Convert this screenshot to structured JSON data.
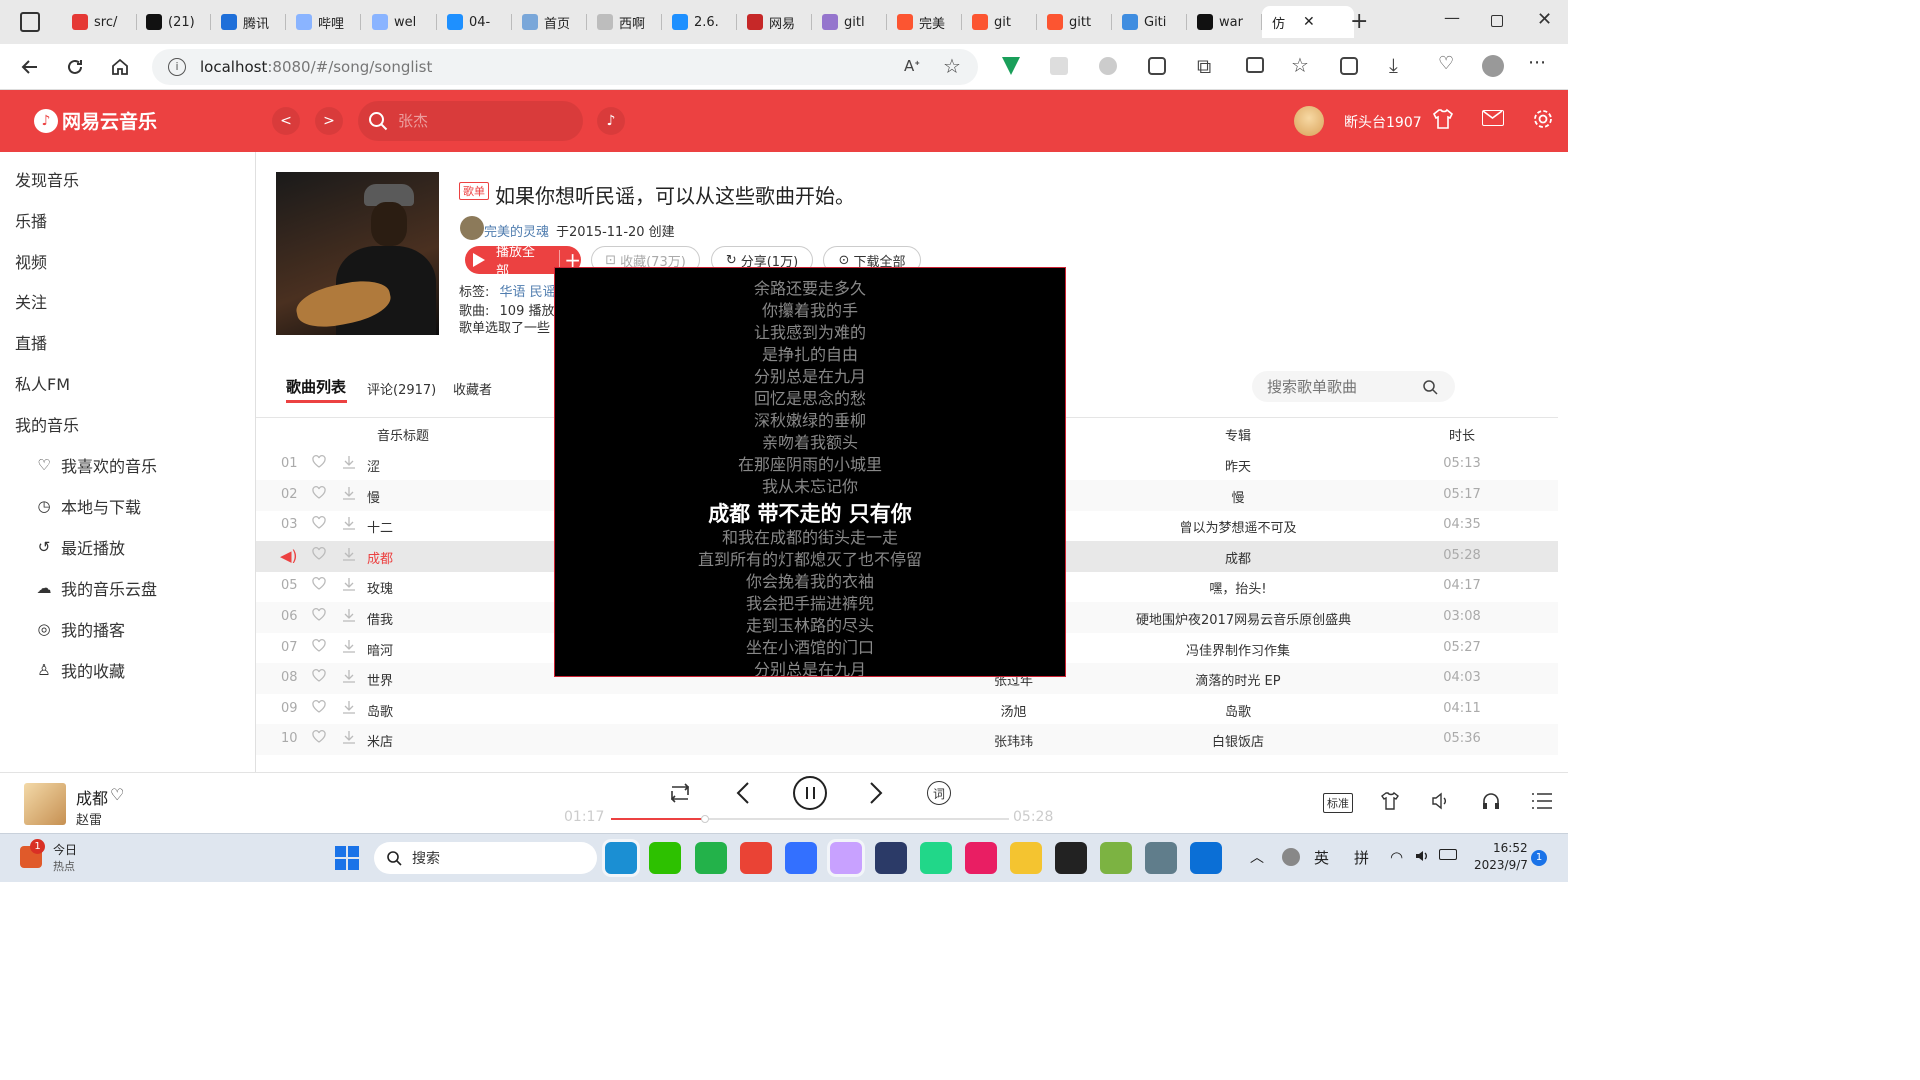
{
  "browser": {
    "tabs": [
      {
        "label": "src/",
        "icon": "gitee-icon",
        "color": "#e53935"
      },
      {
        "label": "(21)",
        "icon": "x-icon",
        "color": "#111111"
      },
      {
        "label": "腾讯",
        "icon": "tencent-icon",
        "color": "#1e6fd9"
      },
      {
        "label": "哔哩",
        "icon": "bilibili-icon",
        "color": "#8ab4ff"
      },
      {
        "label": "wel",
        "icon": "bilibili-icon",
        "color": "#8ab4ff"
      },
      {
        "label": "04-",
        "icon": "bilibili-icon",
        "color": "#1e90ff"
      },
      {
        "label": "首页",
        "icon": "ant-icon",
        "color": "#7aa7d9"
      },
      {
        "label": "西啊",
        "icon": "mini-icon",
        "color": "#bdbdbd"
      },
      {
        "label": "2.6.",
        "icon": "bilibili-icon",
        "color": "#1e90ff"
      },
      {
        "label": "网易",
        "icon": "netease-icon",
        "color": "#c62828"
      },
      {
        "label": "gitl",
        "icon": "github-icon",
        "color": "#9575cd"
      },
      {
        "label": "完美",
        "icon": "csdn-icon",
        "color": "#fc5531"
      },
      {
        "label": "git",
        "icon": "csdn-icon",
        "color": "#fc5531"
      },
      {
        "label": "gitt",
        "icon": "csdn-icon",
        "color": "#fc5531"
      },
      {
        "label": "Giti",
        "icon": "cloud-icon",
        "color": "#3f8de0"
      },
      {
        "label": "war",
        "icon": "github-icon",
        "color": "#111111"
      },
      {
        "label": "仿",
        "icon": "",
        "color": "#ffffff"
      }
    ],
    "url_host": "localhost",
    "url_rest": ":8080/#/song/songlist"
  },
  "app": {
    "logo_text": "网易云音乐",
    "back": "<",
    "forward": ">",
    "search_placeholder": "张杰",
    "username": "断头台1907"
  },
  "sidebar": {
    "items": [
      "发现音乐",
      "乐播",
      "视频",
      "关注",
      "直播",
      "私人FM",
      "我的音乐"
    ],
    "sub_items": [
      {
        "label": "我喜欢的音乐",
        "icon": "heart-icon"
      },
      {
        "label": "本地与下载",
        "icon": "clock-icon"
      },
      {
        "label": "最近播放",
        "icon": "history-icon"
      },
      {
        "label": "我的音乐云盘",
        "icon": "cloud-icon"
      },
      {
        "label": "我的播客",
        "icon": "podcast-icon"
      },
      {
        "label": "我的收藏",
        "icon": "user-icon"
      }
    ]
  },
  "playlist": {
    "tag": "歌单",
    "title": "如果你想听民谣，可以从这些歌曲开始。",
    "creator": "完美的灵魂",
    "created": "于2015-11-20 创建",
    "play_all": "播放全部",
    "collect": "收藏(73万)",
    "share": "分享(1万)",
    "download": "下载全部",
    "tags_label": "标签:",
    "tags": "华语  民谣",
    "songs_label": "歌曲:",
    "songs_value": "109  播放",
    "desc": "歌单选取了一些"
  },
  "tabs": {
    "songlist": "歌曲列表",
    "comments": "评论(2917)",
    "collectors": "收藏者",
    "search_placeholder": "搜索歌单歌曲"
  },
  "table": {
    "headers": {
      "title": "音乐标题",
      "album": "专辑",
      "duration": "时长"
    },
    "rows": [
      {
        "num": "01",
        "title": "涩",
        "artist": "",
        "album": "昨天",
        "duration": "05:13"
      },
      {
        "num": "02",
        "title": "慢",
        "artist": "",
        "album": "慢",
        "duration": "05:17"
      },
      {
        "num": "03",
        "title": "十二",
        "artist": "",
        "album": "曾以为梦想遥不可及",
        "duration": "04:35"
      },
      {
        "num": "",
        "title": "成都",
        "artist": "",
        "album": "成都",
        "duration": "05:28"
      },
      {
        "num": "05",
        "title": "玫瑰",
        "artist": "",
        "album": "嘿，抬头!",
        "duration": "04:17"
      },
      {
        "num": "06",
        "title": "借我",
        "artist": "",
        "album": "硬地围炉夜2017网易云音乐原创盛典",
        "duration": "03:08"
      },
      {
        "num": "07",
        "title": "暗河",
        "artist": "",
        "album": "冯佳界制作习作集",
        "duration": "05:27"
      },
      {
        "num": "08",
        "title": "世界",
        "artist": "张过年",
        "album": "滴落的时光 EP",
        "duration": "04:03"
      },
      {
        "num": "09",
        "title": "岛歌",
        "artist": "汤旭",
        "album": "岛歌",
        "duration": "04:11"
      },
      {
        "num": "10",
        "title": "米店",
        "artist": "张玮玮",
        "album": "白银饭店",
        "duration": "05:36"
      }
    ]
  },
  "lyrics": {
    "lines": [
      "余路还要走多久",
      "你攥着我的手",
      "让我感到为难的",
      "是挣扎的自由",
      "分别总是在九月",
      "回忆是思念的愁",
      "深秋嫩绿的垂柳",
      "亲吻着我额头",
      "在那座阴雨的小城里",
      "我从未忘记你",
      "成都 带不走的 只有你",
      "和我在成都的街头走一走",
      "直到所有的灯都熄灭了也不停留",
      "你会挽着我的衣袖",
      "我会把手揣进裤兜",
      "走到玉林路的尽头",
      "坐在小酒馆的门口",
      "分别总是在九月"
    ],
    "current_index": 10
  },
  "player": {
    "song": "成都",
    "artist": "赵雷",
    "current": "01:17",
    "total": "05:28",
    "progress": 0.235,
    "quality": "标准",
    "lyric_btn": "词"
  },
  "taskbar": {
    "weather_title": "今日",
    "weather_sub": "热点",
    "badge": "1",
    "search": "搜索",
    "ime1": "英",
    "ime2": "拼",
    "time": "16:52",
    "date": "2023/9/7",
    "notif": "1"
  },
  "colors": {
    "brand": "#ec4141"
  }
}
